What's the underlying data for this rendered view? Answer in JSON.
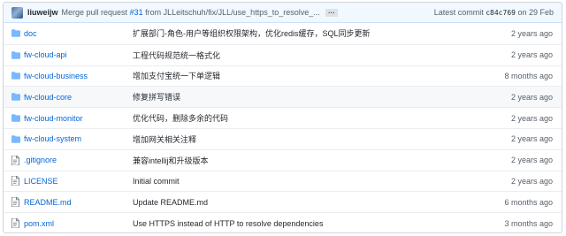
{
  "commit_bar": {
    "author": "liuweijw",
    "message_prefix": "Merge pull request",
    "issue": "#31",
    "message_rest": "from JLLeitschuh/fix/JLL/use_https_to_resolve_...",
    "ellipsis": "…",
    "latest_label": "Latest commit",
    "sha": "c84c769",
    "date": "on 29 Feb"
  },
  "files": [
    {
      "type": "folder",
      "icon": "folder-icon",
      "name": "doc",
      "message": "扩展部门-角色-用户等组织权限架构，优化redis缓存，SQL同步更新",
      "age": "2 years ago"
    },
    {
      "type": "folder",
      "icon": "folder-icon",
      "name": "fw-cloud-api",
      "message": "工程代码规范统一格式化",
      "age": "2 years ago"
    },
    {
      "type": "folder",
      "icon": "folder-icon",
      "name": "fw-cloud-business",
      "message": "增加支付宝统一下单逻辑",
      "age": "8 months ago"
    },
    {
      "type": "folder",
      "icon": "folder-icon",
      "name": "fw-cloud-core",
      "message": "修复拼写错误",
      "age": "2 years ago"
    },
    {
      "type": "folder",
      "icon": "folder-icon",
      "name": "fw-cloud-monitor",
      "message": "优化代码，删除多余的代码",
      "age": "2 years ago"
    },
    {
      "type": "folder",
      "icon": "folder-icon",
      "name": "fw-cloud-system",
      "message": "增加网关相关注释",
      "age": "2 years ago"
    },
    {
      "type": "file",
      "icon": "file-icon",
      "name": ".gitignore",
      "message": "兼容intellij和升级版本",
      "age": "2 years ago"
    },
    {
      "type": "file",
      "icon": "file-icon",
      "name": "LICENSE",
      "message": "Initial commit",
      "age": "2 years ago"
    },
    {
      "type": "file",
      "icon": "file-icon",
      "name": "README.md",
      "message": "Update README.md",
      "age": "6 months ago"
    },
    {
      "type": "file",
      "icon": "file-icon",
      "name": "pom.xml",
      "message": "Use HTTPS instead of HTTP to resolve dependencies",
      "age": "3 months ago"
    }
  ],
  "highlighted_row": "fw-cloud-core",
  "colors": {
    "link": "#0366d6",
    "folder": "#79b8ff",
    "file": "#6a737d",
    "commit_bg": "#f1f8ff"
  }
}
